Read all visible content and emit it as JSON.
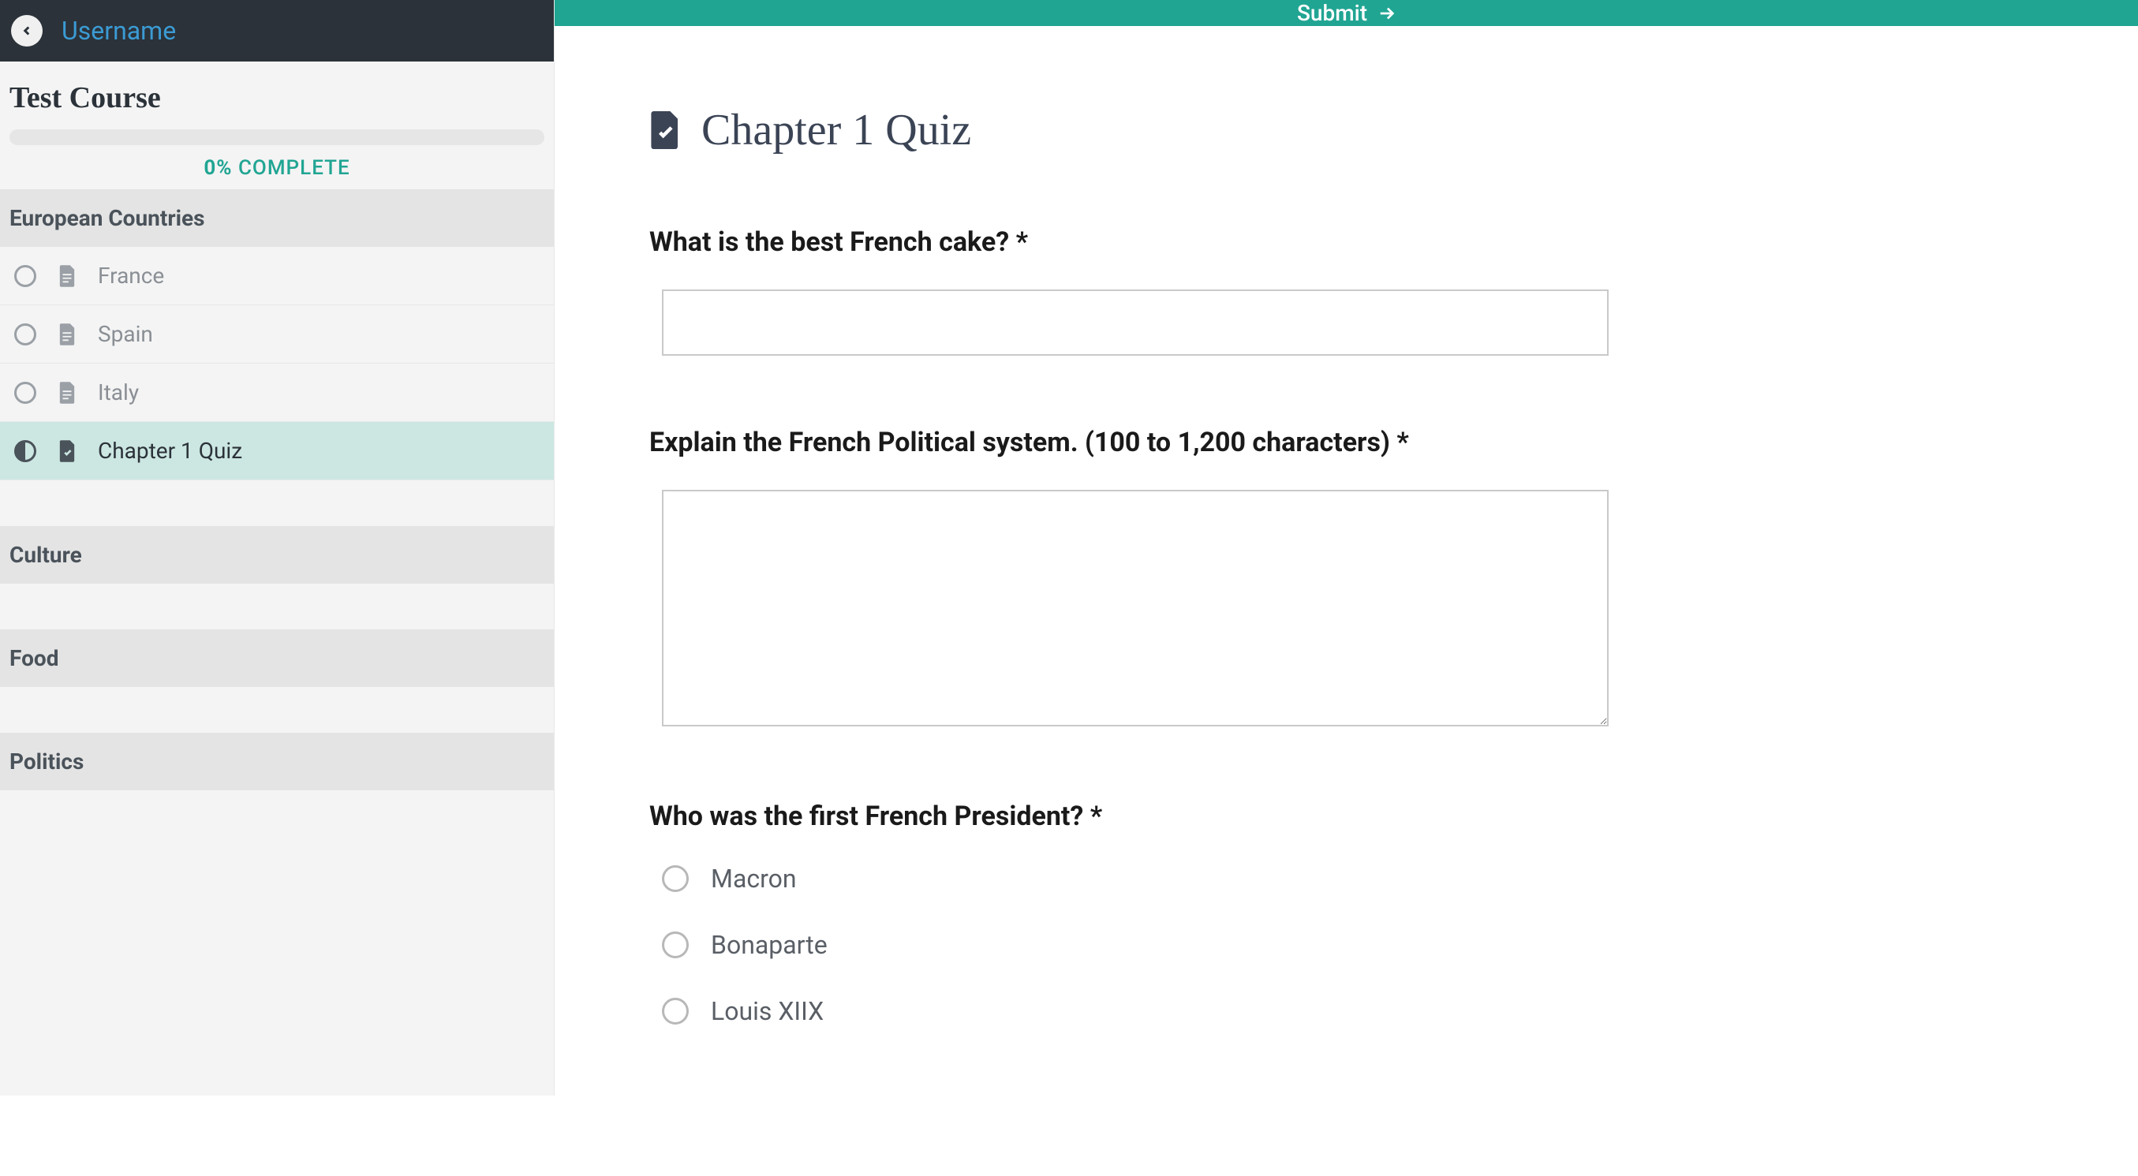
{
  "header": {
    "username": "Username"
  },
  "sidebar": {
    "course_title": "Test Course",
    "progress_pct": "0%",
    "progress_word": "COMPLETE",
    "sections": [
      {
        "title": "European Countries",
        "items": [
          {
            "label": "France",
            "active": false,
            "type": "doc"
          },
          {
            "label": "Spain",
            "active": false,
            "type": "doc"
          },
          {
            "label": "Italy",
            "active": false,
            "type": "doc"
          },
          {
            "label": "Chapter 1 Quiz",
            "active": true,
            "type": "quiz"
          }
        ]
      },
      {
        "title": "Culture",
        "items": []
      },
      {
        "title": "Food",
        "items": []
      },
      {
        "title": "Politics",
        "items": []
      }
    ]
  },
  "topbar": {
    "submit_label": "Submit"
  },
  "main": {
    "page_title": "Chapter 1 Quiz",
    "questions": {
      "q1": {
        "label": "What is the best French cake? *",
        "value": ""
      },
      "q2": {
        "label": "Explain the French Political system. (100 to 1,200 characters) *",
        "value": ""
      },
      "q3": {
        "label": "Who was the first French President? *",
        "options": [
          "Macron",
          "Bonaparte",
          "Louis XIIX"
        ]
      }
    }
  },
  "colors": {
    "accent": "#21a593",
    "link": "#3b9bd4",
    "dark": "#2b3239"
  }
}
